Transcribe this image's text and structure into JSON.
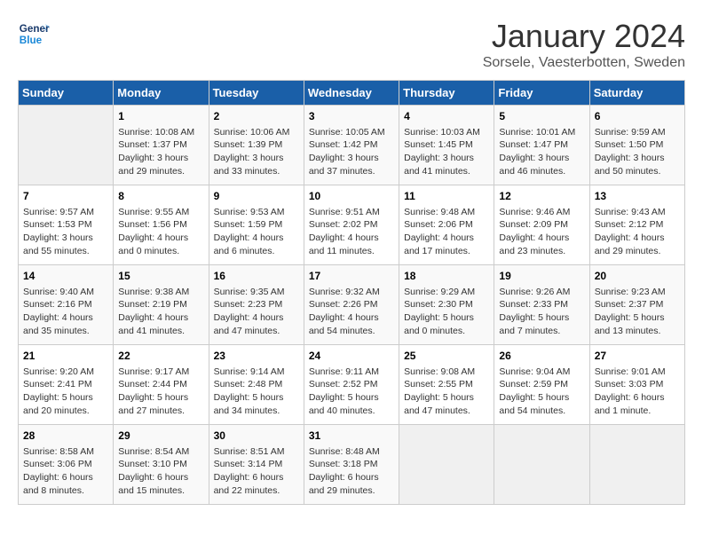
{
  "logo": {
    "line1": "General",
    "line2": "Blue"
  },
  "title": "January 2024",
  "subtitle": "Sorsele, Vaesterbotten, Sweden",
  "headers": [
    "Sunday",
    "Monday",
    "Tuesday",
    "Wednesday",
    "Thursday",
    "Friday",
    "Saturday"
  ],
  "weeks": [
    [
      {
        "num": "",
        "info": ""
      },
      {
        "num": "1",
        "info": "Sunrise: 10:08 AM\nSunset: 1:37 PM\nDaylight: 3 hours\nand 29 minutes."
      },
      {
        "num": "2",
        "info": "Sunrise: 10:06 AM\nSunset: 1:39 PM\nDaylight: 3 hours\nand 33 minutes."
      },
      {
        "num": "3",
        "info": "Sunrise: 10:05 AM\nSunset: 1:42 PM\nDaylight: 3 hours\nand 37 minutes."
      },
      {
        "num": "4",
        "info": "Sunrise: 10:03 AM\nSunset: 1:45 PM\nDaylight: 3 hours\nand 41 minutes."
      },
      {
        "num": "5",
        "info": "Sunrise: 10:01 AM\nSunset: 1:47 PM\nDaylight: 3 hours\nand 46 minutes."
      },
      {
        "num": "6",
        "info": "Sunrise: 9:59 AM\nSunset: 1:50 PM\nDaylight: 3 hours\nand 50 minutes."
      }
    ],
    [
      {
        "num": "7",
        "info": "Sunrise: 9:57 AM\nSunset: 1:53 PM\nDaylight: 3 hours\nand 55 minutes."
      },
      {
        "num": "8",
        "info": "Sunrise: 9:55 AM\nSunset: 1:56 PM\nDaylight: 4 hours\nand 0 minutes."
      },
      {
        "num": "9",
        "info": "Sunrise: 9:53 AM\nSunset: 1:59 PM\nDaylight: 4 hours\nand 6 minutes."
      },
      {
        "num": "10",
        "info": "Sunrise: 9:51 AM\nSunset: 2:02 PM\nDaylight: 4 hours\nand 11 minutes."
      },
      {
        "num": "11",
        "info": "Sunrise: 9:48 AM\nSunset: 2:06 PM\nDaylight: 4 hours\nand 17 minutes."
      },
      {
        "num": "12",
        "info": "Sunrise: 9:46 AM\nSunset: 2:09 PM\nDaylight: 4 hours\nand 23 minutes."
      },
      {
        "num": "13",
        "info": "Sunrise: 9:43 AM\nSunset: 2:12 PM\nDaylight: 4 hours\nand 29 minutes."
      }
    ],
    [
      {
        "num": "14",
        "info": "Sunrise: 9:40 AM\nSunset: 2:16 PM\nDaylight: 4 hours\nand 35 minutes."
      },
      {
        "num": "15",
        "info": "Sunrise: 9:38 AM\nSunset: 2:19 PM\nDaylight: 4 hours\nand 41 minutes."
      },
      {
        "num": "16",
        "info": "Sunrise: 9:35 AM\nSunset: 2:23 PM\nDaylight: 4 hours\nand 47 minutes."
      },
      {
        "num": "17",
        "info": "Sunrise: 9:32 AM\nSunset: 2:26 PM\nDaylight: 4 hours\nand 54 minutes."
      },
      {
        "num": "18",
        "info": "Sunrise: 9:29 AM\nSunset: 2:30 PM\nDaylight: 5 hours\nand 0 minutes."
      },
      {
        "num": "19",
        "info": "Sunrise: 9:26 AM\nSunset: 2:33 PM\nDaylight: 5 hours\nand 7 minutes."
      },
      {
        "num": "20",
        "info": "Sunrise: 9:23 AM\nSunset: 2:37 PM\nDaylight: 5 hours\nand 13 minutes."
      }
    ],
    [
      {
        "num": "21",
        "info": "Sunrise: 9:20 AM\nSunset: 2:41 PM\nDaylight: 5 hours\nand 20 minutes."
      },
      {
        "num": "22",
        "info": "Sunrise: 9:17 AM\nSunset: 2:44 PM\nDaylight: 5 hours\nand 27 minutes."
      },
      {
        "num": "23",
        "info": "Sunrise: 9:14 AM\nSunset: 2:48 PM\nDaylight: 5 hours\nand 34 minutes."
      },
      {
        "num": "24",
        "info": "Sunrise: 9:11 AM\nSunset: 2:52 PM\nDaylight: 5 hours\nand 40 minutes."
      },
      {
        "num": "25",
        "info": "Sunrise: 9:08 AM\nSunset: 2:55 PM\nDaylight: 5 hours\nand 47 minutes."
      },
      {
        "num": "26",
        "info": "Sunrise: 9:04 AM\nSunset: 2:59 PM\nDaylight: 5 hours\nand 54 minutes."
      },
      {
        "num": "27",
        "info": "Sunrise: 9:01 AM\nSunset: 3:03 PM\nDaylight: 6 hours\nand 1 minute."
      }
    ],
    [
      {
        "num": "28",
        "info": "Sunrise: 8:58 AM\nSunset: 3:06 PM\nDaylight: 6 hours\nand 8 minutes."
      },
      {
        "num": "29",
        "info": "Sunrise: 8:54 AM\nSunset: 3:10 PM\nDaylight: 6 hours\nand 15 minutes."
      },
      {
        "num": "30",
        "info": "Sunrise: 8:51 AM\nSunset: 3:14 PM\nDaylight: 6 hours\nand 22 minutes."
      },
      {
        "num": "31",
        "info": "Sunrise: 8:48 AM\nSunset: 3:18 PM\nDaylight: 6 hours\nand 29 minutes."
      },
      {
        "num": "",
        "info": ""
      },
      {
        "num": "",
        "info": ""
      },
      {
        "num": "",
        "info": ""
      }
    ]
  ]
}
